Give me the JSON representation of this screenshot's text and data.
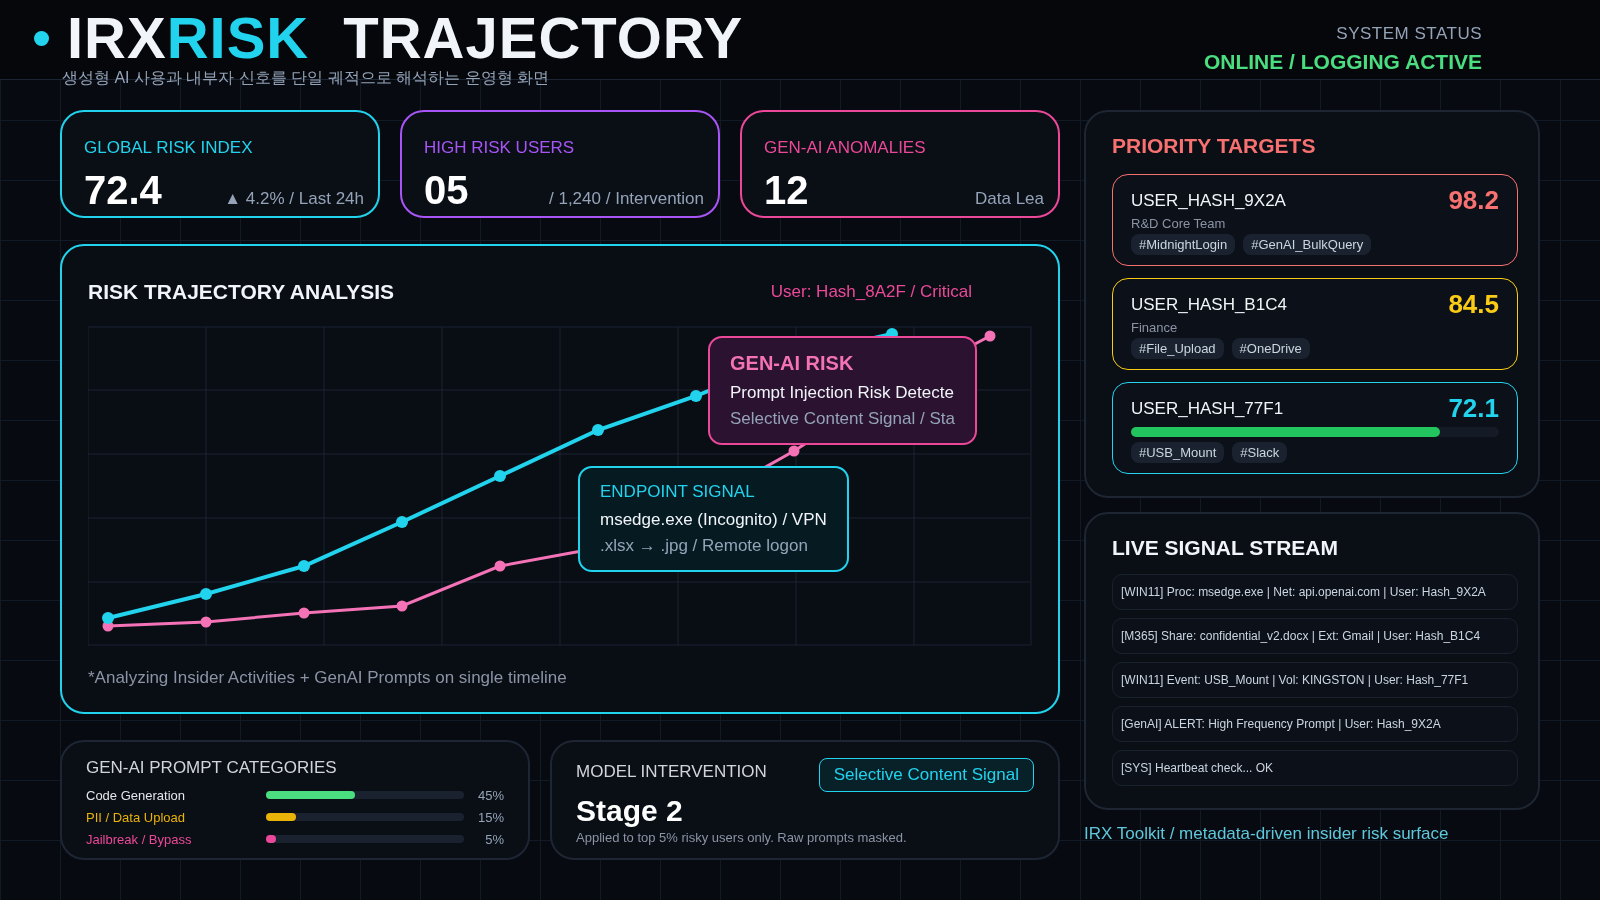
{
  "header": {
    "title_parts": [
      {
        "text": "IRX",
        "accent": false
      },
      {
        "text": "RISK",
        "accent": true
      },
      {
        "text": "TRAJECTORY",
        "accent": false
      }
    ],
    "subtitle": "생성형 AI 사용과 내부자 신호를 단일 궤적으로 해석하는 운영형 화면",
    "status_label": "SYSTEM STATUS",
    "status_value": "ONLINE / LOGGING ACTIVE"
  },
  "kpis": [
    {
      "label": "GLOBAL RISK INDEX",
      "value": "72.4",
      "note": "▲ 4.2% / Last 24h",
      "color": "#22d3ee"
    },
    {
      "label": "HIGH RISK USERS",
      "value": "05",
      "note": "/ 1,240 / Intervention",
      "color": "#a855f7"
    },
    {
      "label": "GEN-AI ANOMALIES",
      "value": "12",
      "note": "Data Lea",
      "color": "#ec4899"
    }
  ],
  "chart": {
    "title": "RISK TRAJECTORY ANALYSIS",
    "flag": "User: Hash_8A2F / Critical",
    "footnote": "*Analyzing Insider Activities + GenAI Prompts on single timeline",
    "tooltips": [
      {
        "kind": "endpoint",
        "title": "ENDPOINT SIGNAL",
        "line1": "msedge.exe (Incognito) / VPN",
        "line2": ".xlsx → .jpg / Remote logon"
      },
      {
        "kind": "genai",
        "title": "GEN-AI RISK",
        "line1": "Prompt Injection Risk Detecte",
        "line2": "Selective Content Signal / Sta"
      }
    ]
  },
  "categories": {
    "title": "GEN-AI PROMPT CATEGORIES",
    "items": [
      {
        "label": "Code Generation",
        "percent": "45%",
        "level": 0.45,
        "color": "#4ade80"
      },
      {
        "label": "PII / Data Upload",
        "percent": "15%",
        "level": 0.15,
        "color": "#eab308"
      },
      {
        "label": "Jailbreak / Bypass",
        "percent": "5%",
        "level": 0.05,
        "color": "#ec4899"
      }
    ]
  },
  "intervention": {
    "title": "MODEL INTERVENTION",
    "stage": "Stage 2",
    "badge": "Selective Content Signal",
    "note": "Applied to top 5% risky users only. Raw prompts masked."
  },
  "priority_targets": {
    "title": "PRIORITY TARGETS",
    "items": [
      {
        "user": "USER_HASH_9X2A",
        "score": "98.2",
        "department": "R&D Core Team",
        "tags": [
          "#MidnightLogin",
          "#GenAI_BulkQuery"
        ],
        "color": "#f87171"
      },
      {
        "user": "USER_HASH_B1C4",
        "score": "84.5",
        "department": "Finance",
        "tags": [
          "#File_Upload",
          "#OneDrive"
        ],
        "color": "#facc15"
      },
      {
        "user": "USER_HASH_77F1",
        "score": "72.1",
        "level": 0.84,
        "tags": [
          "#USB_Mount",
          "#Slack"
        ],
        "color": "#22d3ee"
      }
    ]
  },
  "live_stream": {
    "title": "LIVE SIGNAL STREAM",
    "entries": [
      "[WIN11] Proc: msedge.exe | Net: api.openai.com | User: Hash_9X2A",
      "[M365] Share: confidential_v2.docx | Ext: Gmail | User: Hash_B1C4",
      "[WIN11] Event: USB_Mount | Vol: KINGSTON | User: Hash_77F1",
      "[GenAI] ALERT: High Frequency Prompt | User: Hash_9X2A",
      "[SYS] Heartbeat check... OK"
    ]
  },
  "footer": "IRX Toolkit / metadata-driven insider risk surface"
}
